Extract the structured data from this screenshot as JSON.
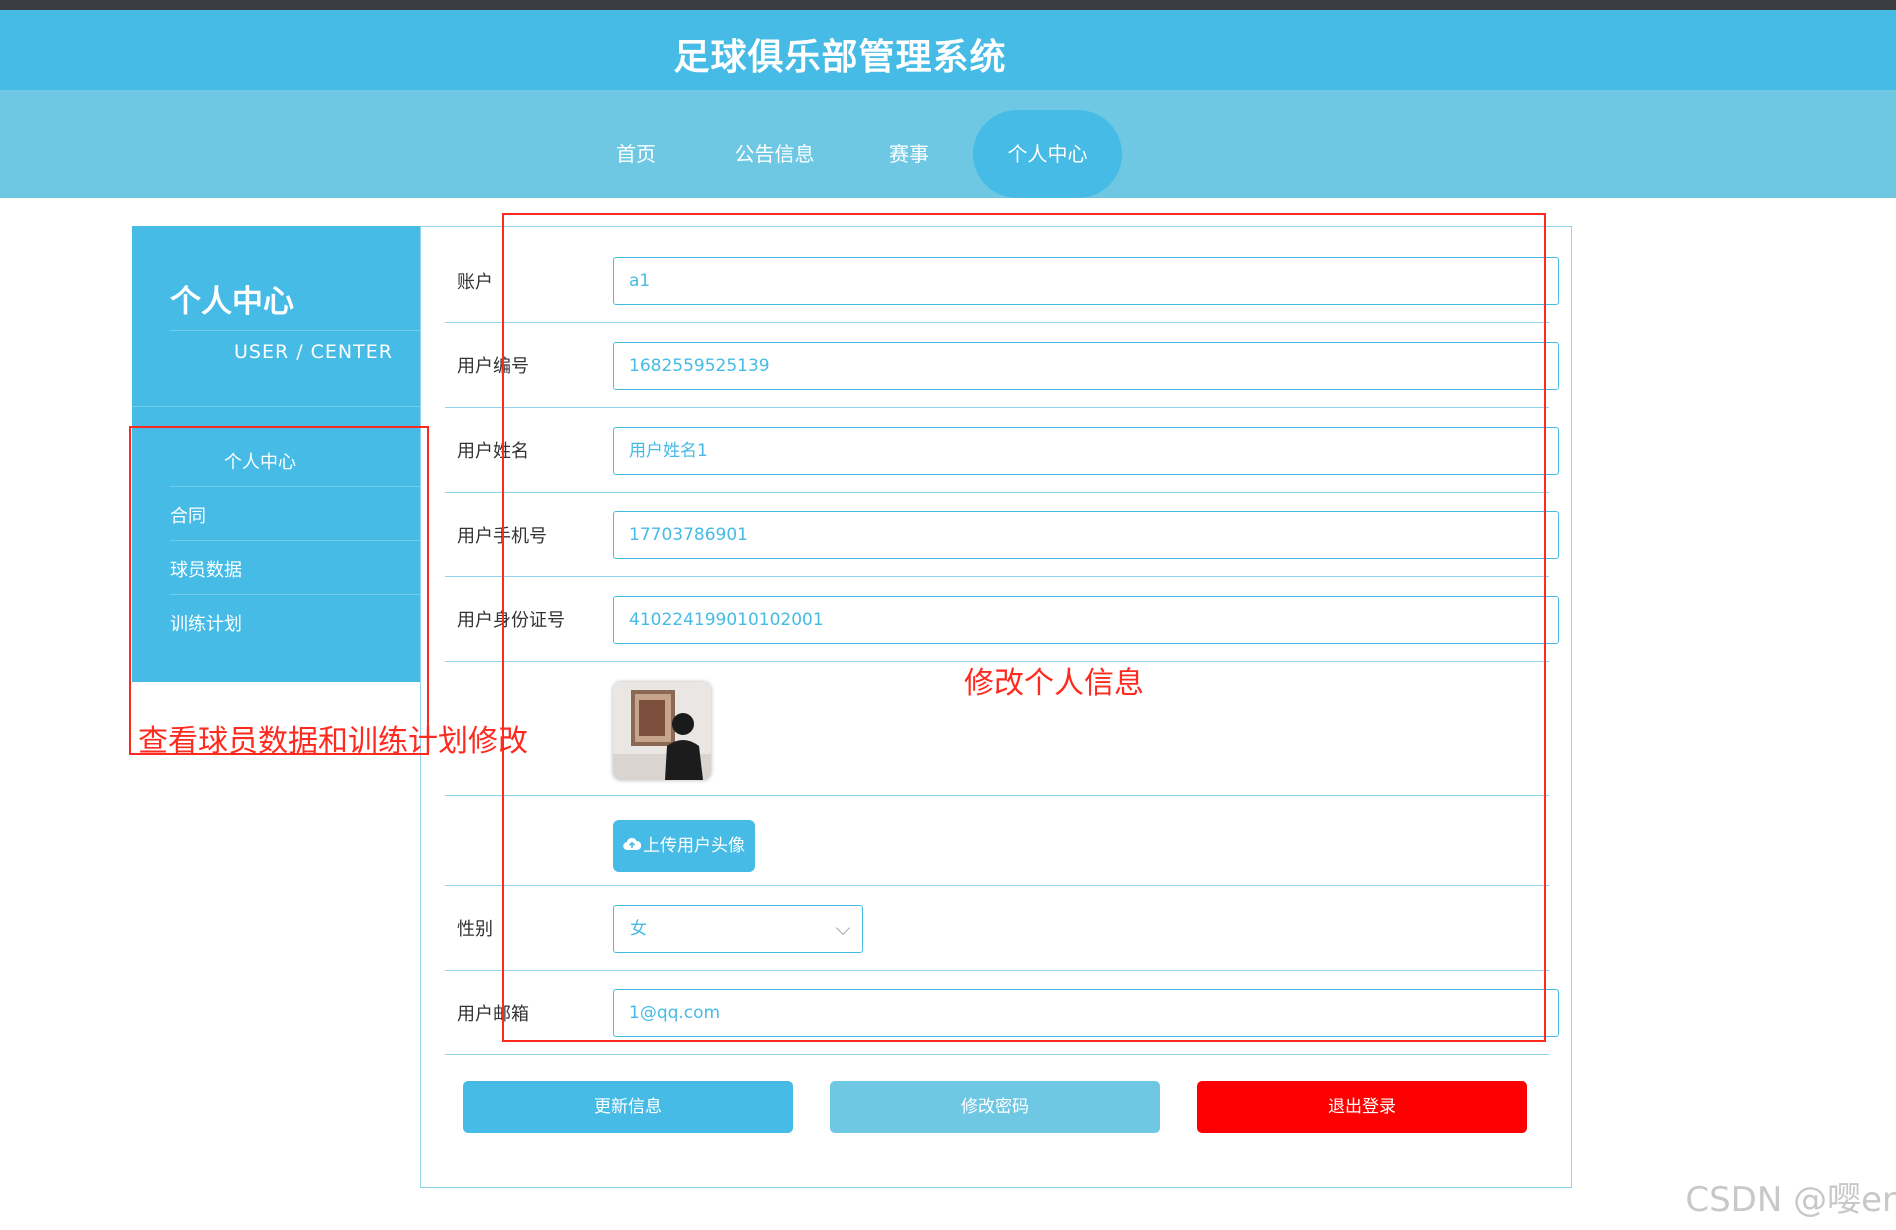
{
  "app": {
    "title": "足球俱乐部管理系统"
  },
  "nav": {
    "items": [
      "首页",
      "公告信息",
      "赛事",
      "个人中心"
    ],
    "active": "个人中心"
  },
  "sidebar": {
    "title": "个人中心",
    "subtitle": "USER / CENTER",
    "items": [
      "个人中心",
      "合同",
      "球员数据",
      "训练计划"
    ]
  },
  "form": {
    "account": {
      "label": "账户",
      "value": "a1"
    },
    "user_no": {
      "label": "用户编号",
      "value": "1682559525139"
    },
    "user_name": {
      "label": "用户姓名",
      "value": "用户姓名1"
    },
    "phone": {
      "label": "用户手机号",
      "value": "17703786901"
    },
    "id_card": {
      "label": "用户身份证号",
      "value": "410224199010102001"
    },
    "upload_label": "上传用户头像",
    "gender": {
      "label": "性别",
      "value": "女"
    },
    "email": {
      "label": "用户邮箱",
      "value": "1@qq.com"
    }
  },
  "buttons": {
    "update": "更新信息",
    "change_password": "修改密码",
    "logout": "退出登录"
  },
  "colors": {
    "primary": "#45bbe6",
    "nav_bg": "#6ec8e4",
    "light_btn": "#6ec8e4",
    "logout": "#ff0000",
    "annotation": "#ff2a1f"
  },
  "annotations": {
    "right_note": "修改个人信息",
    "left_note": "查看球员数据和训练计划修改"
  },
  "watermark": "CSDN @嘤er"
}
